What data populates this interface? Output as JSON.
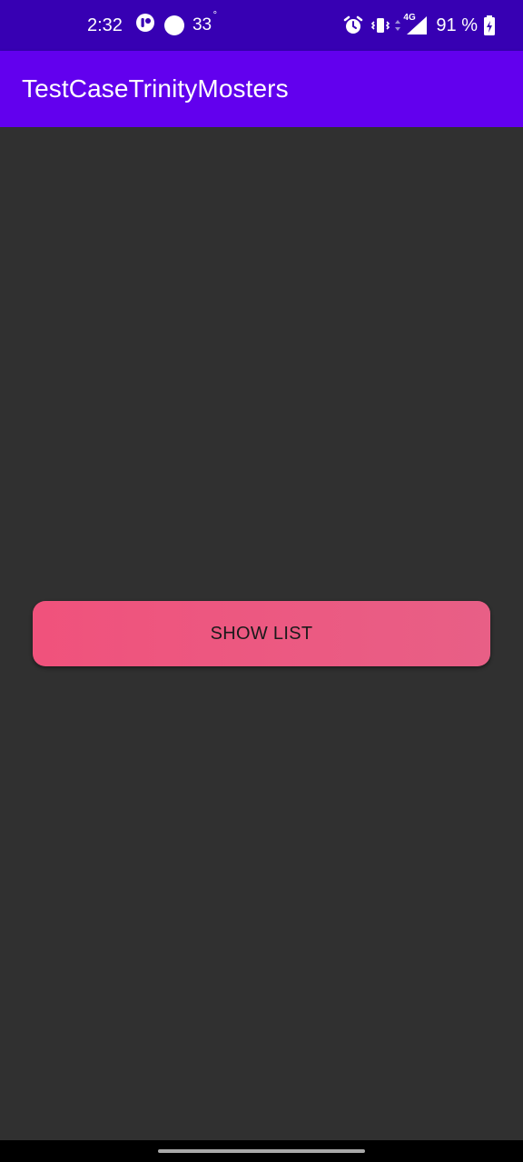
{
  "status_bar": {
    "time": "2:32",
    "temperature": "33",
    "battery": "91 %",
    "network": "4G",
    "icons": [
      "app-notification-icon",
      "weather-icon",
      "alarm-icon",
      "vibrate-icon",
      "data-arrows-icon",
      "signal-icon",
      "battery-charging-icon"
    ]
  },
  "app_bar": {
    "title": "TestCaseTrinityMosters"
  },
  "main": {
    "show_list_label": "SHOW LIST"
  },
  "colors": {
    "status_bar": "#3700b3",
    "app_bar": "#6200ee",
    "background": "#303030",
    "button": "#f0527c"
  }
}
